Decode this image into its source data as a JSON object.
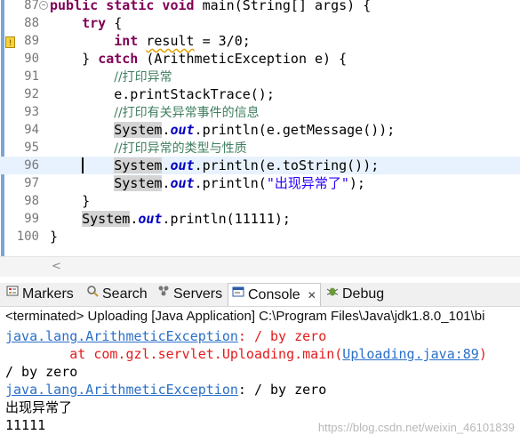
{
  "editor": {
    "lines": [
      {
        "num": "87",
        "tokens": [
          [
            "kw",
            "public static void "
          ],
          [
            "",
            "main(String[] args) {"
          ]
        ]
      },
      {
        "num": "88",
        "tokens": [
          [
            "",
            "    "
          ],
          [
            "kw",
            "try"
          ],
          [
            "",
            " {"
          ]
        ]
      },
      {
        "num": "89",
        "tokens": [
          [
            "",
            "        "
          ],
          [
            "kw",
            "int"
          ],
          [
            "",
            " "
          ],
          [
            "squig",
            "result"
          ],
          [
            "",
            " = 3/0;"
          ]
        ]
      },
      {
        "num": "90",
        "tokens": [
          [
            "",
            "    } "
          ],
          [
            "kw",
            "catch"
          ],
          [
            "",
            " (ArithmeticException e) {"
          ]
        ]
      },
      {
        "num": "91",
        "tokens": [
          [
            "",
            "        "
          ],
          [
            "cm",
            "//打印异常"
          ]
        ]
      },
      {
        "num": "92",
        "tokens": [
          [
            "",
            "        e.printStackTrace();"
          ]
        ]
      },
      {
        "num": "93",
        "tokens": [
          [
            "",
            "        "
          ],
          [
            "cm",
            "//打印有关异常事件的信息"
          ]
        ]
      },
      {
        "num": "94",
        "tokens": [
          [
            "",
            "        "
          ],
          [
            "hl",
            "System"
          ],
          [
            "",
            "."
          ],
          [
            "fld",
            "out"
          ],
          [
            "",
            ".println(e.getMessage());"
          ]
        ]
      },
      {
        "num": "95",
        "tokens": [
          [
            "",
            "        "
          ],
          [
            "cm",
            "//打印异常的类型与性质"
          ]
        ]
      },
      {
        "num": "96",
        "tokens": [
          [
            "",
            "        "
          ],
          [
            "hl",
            "System"
          ],
          [
            "",
            "."
          ],
          [
            "fld",
            "out"
          ],
          [
            "",
            ".println(e.toString());"
          ]
        ]
      },
      {
        "num": "97",
        "tokens": [
          [
            "",
            "        "
          ],
          [
            "hl",
            "System"
          ],
          [
            "",
            "."
          ],
          [
            "fld",
            "out"
          ],
          [
            "",
            ".println("
          ],
          [
            "str",
            "\"出现异常了\""
          ],
          [
            "",
            ");"
          ]
        ]
      },
      {
        "num": "98",
        "tokens": [
          [
            "",
            "    }"
          ]
        ]
      },
      {
        "num": "99",
        "tokens": [
          [
            "",
            "    "
          ],
          [
            "hl",
            "System"
          ],
          [
            "",
            "."
          ],
          [
            "fld",
            "out"
          ],
          [
            "",
            ".println(11111);"
          ]
        ]
      },
      {
        "num": "100",
        "tokens": [
          [
            "",
            "}"
          ]
        ]
      }
    ]
  },
  "tabs": {
    "markers": "Markers",
    "search": "Search",
    "servers": "Servers",
    "console": "Console",
    "console_close": "✕",
    "debug": "Debug"
  },
  "status": "<terminated> Uploading [Java Application] C:\\Program Files\\Java\\jdk1.8.0_101\\bi",
  "console": {
    "line1_exc": "java.lang.ArithmeticException",
    "line1_rest": ": / by zero",
    "line2_prefix": "        at com.gzl.servlet.Uploading.main(",
    "line2_link": "Uploading.java:89",
    "line2_suffix": ")",
    "line3": "/ by zero",
    "line4_exc": "java.lang.ArithmeticException",
    "line4_rest": ": / by zero",
    "line5": "出现异常了",
    "line6": "11111"
  },
  "watermark": "https://blog.csdn.net/weixin_46101839",
  "colors": {
    "keyword": "#7f0055",
    "comment": "#3f7f5f",
    "field": "#0000c0",
    "string": "#2a00ff",
    "error": "#e31b1b",
    "link": "#2a6fc9"
  }
}
